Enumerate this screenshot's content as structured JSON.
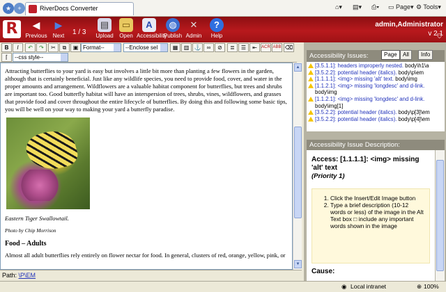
{
  "browser": {
    "tab_title": "RiverDocs Converter",
    "page_menu": "Page",
    "tools_menu": "Tools"
  },
  "header": {
    "buttons": {
      "previous": "Previous",
      "next": "Next",
      "upload": "Upload",
      "open": "Open",
      "accessibility": "Accessibility",
      "publish": "Publish",
      "admin": "Admin",
      "help": "Help"
    },
    "page_indicator": "1 / 3",
    "user": "admin,Administrator",
    "version": "v 2.1"
  },
  "toolbar": {
    "bold": "B",
    "italic": "I",
    "format_select": "Format--",
    "enclose_select": "--Enclose sel",
    "css_select": "--css style--"
  },
  "document": {
    "intro": "Attracting butterflies to your yard is easy but involves a little bit more than planting a few flowers in the garden, although that is certainly beneficial. Just like any wildlife species, you need to provide food, cover, and water in the proper amounts and arrangement. Wildflowers are a valuable habitat component for butterflies, but trees and shrubs are important too. Good butterfly habitat will have an interspersion of trees, shrubs, vines, wildflowers, and grasses that provide food and cover throughout the entire lifecycle of butterflies. By doing this and following some basic tips, you will be well on your way to making your yard a butterfly paradise.",
    "caption": "Eastern Tiger Swallowtail.",
    "credit": "Photo by Chip Morrison",
    "heading": "Food – Adults",
    "para2": "Almost all adult butterflies rely entirely on flower nectar for food. In general, clusters of red, orange, yellow, pink, or"
  },
  "path_bar": {
    "label": "Path:",
    "value": "\\P\\EM"
  },
  "issues_panel": {
    "title": "Accessibility Issues:",
    "tabs": [
      "Page",
      "All",
      "Info"
    ],
    "items": [
      {
        "code": "[3.5.1.1]: headers improperly nested.",
        "path": "body\\h1\\a"
      },
      {
        "code": "[3.5.2.2]: potential header (italics).",
        "path": "body\\p\\em"
      },
      {
        "code": "[1.1.1.1]: <img> missing 'alt' text.",
        "path": "body\\img"
      },
      {
        "code": "[1.1.2.1]: <img> missing 'longdesc' and d-link.",
        "path": "body\\img"
      },
      {
        "code": "[1.1.2.1]: <img> missing 'longdesc' and d-link.",
        "path": "body\\img[1]"
      },
      {
        "code": "[3.5.2.2]: potential header (italics).",
        "path": "body\\p[3]\\em"
      },
      {
        "code": "[3.5.2.2]: potential header (italics).",
        "path": "body\\p[4]\\em"
      }
    ]
  },
  "description_panel": {
    "title": "Accessibility Issue Description:",
    "heading": "Access: [1.1.1.1]: <img> missing 'alt' text",
    "priority": "(Priority 1)",
    "steps": [
      "Click the Insert/Edit Image button",
      "Type a brief description (10-12 words or less) of the image in the Alt Text box □ include any important words shown in the image"
    ],
    "cause_label": "Cause:"
  },
  "status_bar": {
    "zone": "Local intranet",
    "zoom": "100%"
  }
}
